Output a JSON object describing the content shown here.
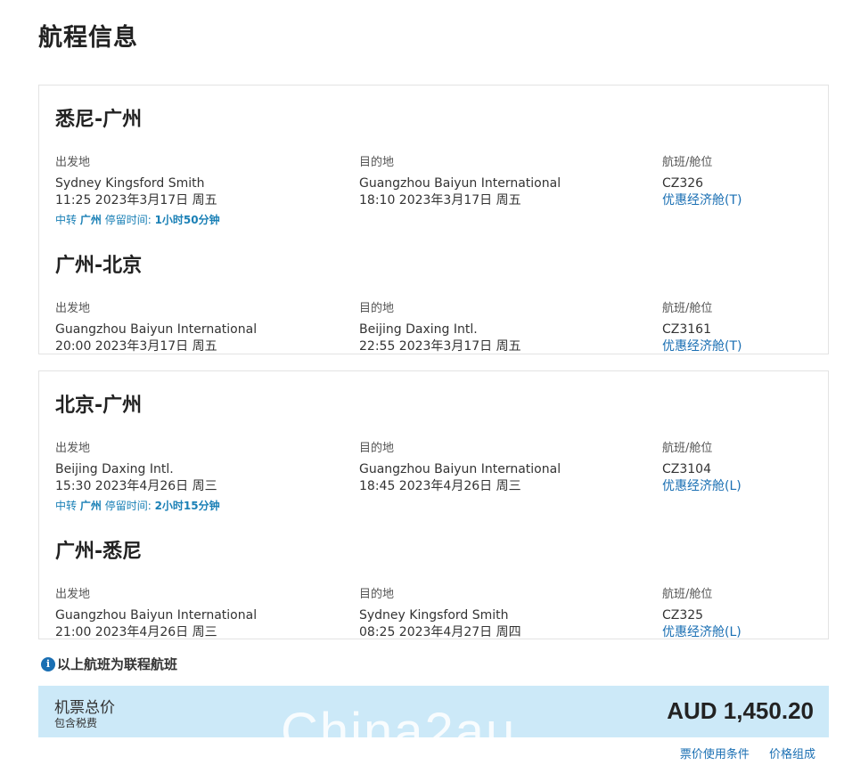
{
  "page": {
    "title": "航程信息"
  },
  "labels": {
    "departure": "出发地",
    "arrival": "目的地",
    "flight": "航班/舱位"
  },
  "trips": [
    {
      "segments": [
        {
          "route": "悉尼-广州",
          "dep_airport": "Sydney Kingsford Smith",
          "dep_time": "11:25 2023年3月17日 周五",
          "arr_airport": "Guangzhou Baiyun International",
          "arr_time": "18:10 2023年3月17日 周五",
          "flight_no": "CZ326",
          "cabin": "优惠经济舱(T)"
        },
        {
          "route": "广州-北京",
          "dep_airport": "Guangzhou Baiyun International",
          "dep_time": "20:00 2023年3月17日 周五",
          "arr_airport": "Beijing Daxing Intl.",
          "arr_time": "22:55 2023年3月17日 周五",
          "flight_no": "CZ3161",
          "cabin": "优惠经济舱(T)"
        }
      ],
      "transfer": {
        "prefix": "中转",
        "city": "广州",
        "stay_label": "停留时间:",
        "duration": "1小时50分钟"
      }
    },
    {
      "segments": [
        {
          "route": "北京-广州",
          "dep_airport": "Beijing Daxing Intl.",
          "dep_time": "15:30 2023年4月26日 周三",
          "arr_airport": "Guangzhou Baiyun International",
          "arr_time": "18:45 2023年4月26日 周三",
          "flight_no": "CZ3104",
          "cabin": "优惠经济舱(L)"
        },
        {
          "route": "广州-悉尼",
          "dep_airport": "Guangzhou Baiyun International",
          "dep_time": "21:00 2023年4月26日 周三",
          "arr_airport": "Sydney Kingsford Smith",
          "arr_time": "08:25 2023年4月27日 周四",
          "flight_no": "CZ325",
          "cabin": "优惠经济舱(L)"
        }
      ],
      "transfer": {
        "prefix": "中转",
        "city": "广州",
        "stay_label": "停留时间:",
        "duration": "2小时15分钟"
      }
    }
  ],
  "note": {
    "icon": "info-icon",
    "icon_glyph": "i",
    "text": "以上航班为联程航班"
  },
  "price": {
    "label": "机票总价",
    "sub": "包含税费",
    "value": "AUD 1,450.20",
    "watermark": "China2au"
  },
  "footer": {
    "terms_link": "票价使用条件",
    "breakdown_link": "价格组成"
  },
  "colors": {
    "accent": "#1a6fb3",
    "price_bar": "#cce9f8",
    "transfer_text": "#1a80b6"
  }
}
